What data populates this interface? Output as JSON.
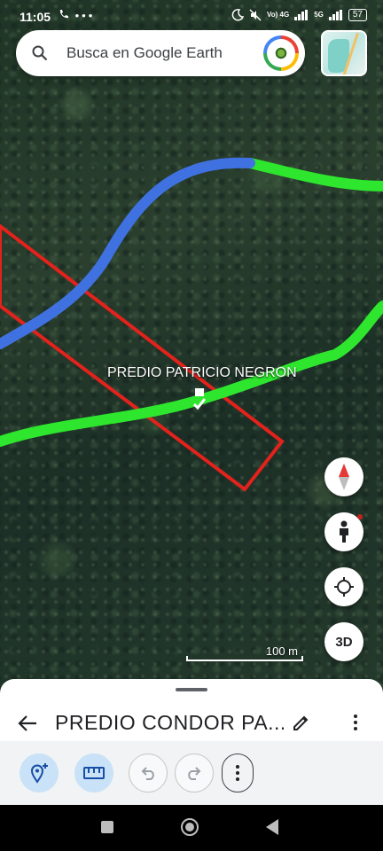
{
  "status_bar": {
    "time": "11:05",
    "left_icons": [
      "phone-icon",
      "more-icon"
    ],
    "network_label_top": "5G",
    "volte_label": "Vo) 4G",
    "battery": "57"
  },
  "search": {
    "placeholder": "Busca en Google Earth"
  },
  "map": {
    "placemark_label": "PREDIO PATRICIO NEGRON",
    "scale_label": "100 m",
    "line_colors": {
      "red_polygon": "#e3221c",
      "blue_path": "#3f72e0",
      "green_path": "#2ee62e"
    }
  },
  "map_buttons": {
    "three_d_label": "3D"
  },
  "sheet": {
    "title": "PREDIO CONDOR PA..."
  },
  "toolbar": {
    "tools": [
      "add-placemark-icon",
      "ruler-icon",
      "undo-icon",
      "redo-icon",
      "more-vertical-icon"
    ]
  },
  "colors": {
    "accent_blue": "#c9e2f7",
    "sheet_bg": "#ffffff",
    "toolbar_bg": "#f1f3f4"
  }
}
